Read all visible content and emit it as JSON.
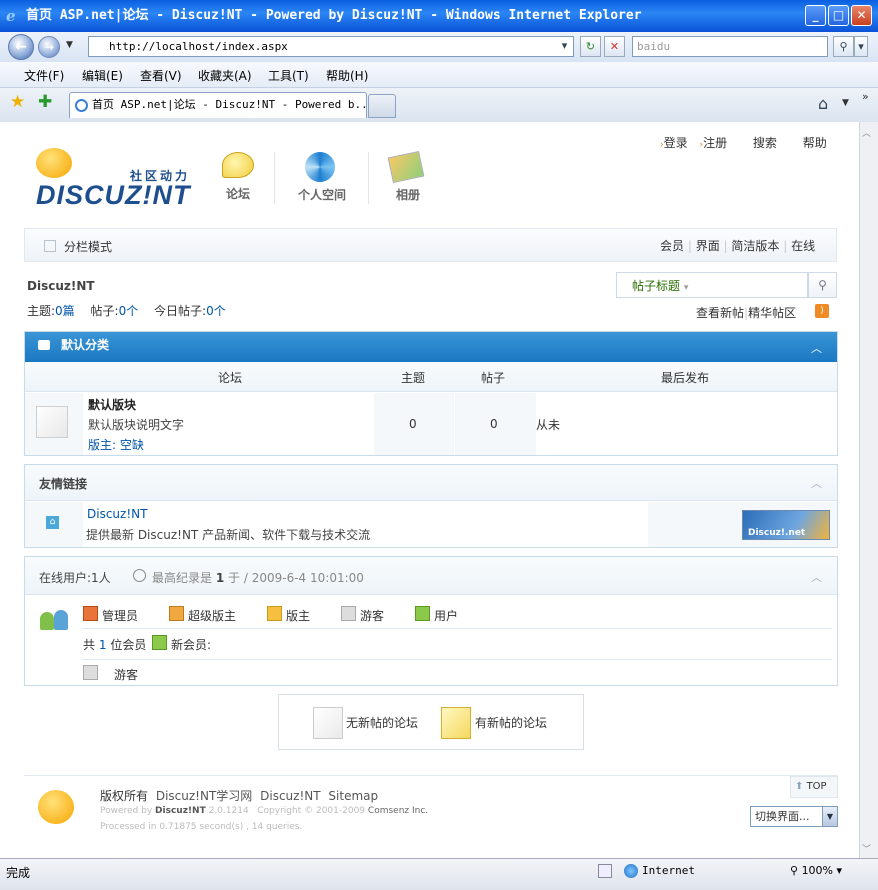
{
  "window": {
    "title": "首页 ASP.net|论坛 - Discuz!NT - Powered by Discuz!NT - Windows Internet Explorer",
    "minimize": "_",
    "maximize": "□",
    "close": "✕"
  },
  "browser": {
    "address": "http://localhost/index.aspx",
    "search_value": "baidu",
    "menus": [
      "文件(F)",
      "编辑(E)",
      "查看(V)",
      "收藏夹(A)",
      "工具(T)",
      "帮助(H)"
    ],
    "tab_title": "首页 ASP.net|论坛 - Discuz!NT - Powered b...",
    "status_left": "完成",
    "status_zone": "Internet",
    "zoom": "100%"
  },
  "site": {
    "logo_subtitle": "社区动力",
    "logo_text": "DISCUZ!NT",
    "nav": [
      {
        "label": "论坛",
        "icon": "smiley-chat-icon"
      },
      {
        "label": "个人空间",
        "icon": "swirl-space-icon"
      },
      {
        "label": "相册",
        "icon": "photo-album-icon"
      }
    ],
    "top_links": [
      "登录",
      "注册",
      "搜索",
      "帮助"
    ],
    "subnav_left": "分栏模式",
    "subnav_right": [
      "会员",
      "界面",
      "简洁版本",
      "在线"
    ]
  },
  "forum": {
    "breadcrumb": "Discuz!NT",
    "search_type": "帖子标题",
    "stats": {
      "topics_label": "主题:",
      "topics_value": "0篇",
      "posts_label": "帖子:",
      "posts_value": "0个",
      "today_label": "今日帖子:",
      "today_value": "0个"
    },
    "quick_links": [
      "查看新帖",
      "精华帖区"
    ],
    "category": {
      "title": "默认分类",
      "headers": [
        "论坛",
        "主题",
        "帖子",
        "最后发布"
      ],
      "rows": [
        {
          "name": "默认版块",
          "desc": "默认版块说明文字",
          "moderator_label": "版主:",
          "moderator": "空缺",
          "topics": "0",
          "posts": "0",
          "last": "从未"
        }
      ]
    },
    "links": {
      "title": "友情链接",
      "name": "Discuz!NT",
      "desc": "提供最新 Discuz!NT 产品新闻、软件下载与技术交流",
      "banner": "Discuz!.net"
    },
    "online": {
      "label": "在线用户:",
      "count": "1人",
      "record_label": "最高纪录是",
      "record_value": "1",
      "record_at": "于",
      "record_date": "2009-6-4 10:01:00",
      "legend": [
        "管理员",
        "超级版主",
        "版主",
        "游客",
        "用户"
      ],
      "members_prefix": "共",
      "members_count": "1",
      "members_suffix": "位会员",
      "new_member_label": "新会员:",
      "guest": "游客"
    },
    "icon_legend": {
      "no_new": "无新帖的论坛",
      "has_new": "有新帖的论坛"
    }
  },
  "footer": {
    "copyright": "版权所有",
    "links": [
      "Discuz!NT学习网",
      "Discuz!NT",
      "Sitemap"
    ],
    "powered": "Powered by",
    "powered_name": "Discuz!NT",
    "version": "2.0.1214",
    "copy_years": "Copyright © 2001-2009",
    "company": "Comsenz Inc.",
    "processed": "Processed in 0.71875 second(s) , 14 queries.",
    "top": "TOP",
    "switch_ui": "切换界面..."
  },
  "colors": {
    "title_bar": "#0a5fe0",
    "category_header": "#1a78c2",
    "link_green": "#286d00",
    "link_blue": "#0055aa"
  }
}
